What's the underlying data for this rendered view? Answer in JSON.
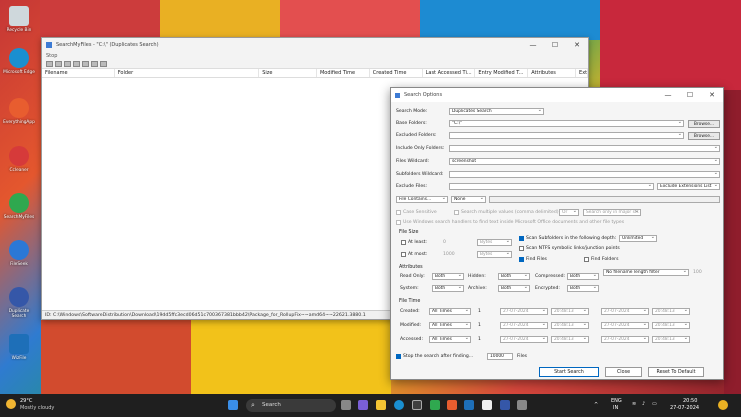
{
  "desktop": {
    "icons": [
      {
        "label": "Recycle Bin",
        "icon": "recycle-bin-icon",
        "color": "#cfd8dc"
      },
      {
        "label": "Microsoft Edge",
        "icon": "edge-icon",
        "color": "#1a8fd0"
      },
      {
        "label": "EverythingApp",
        "icon": "app-icon",
        "color": "#e85d2f"
      },
      {
        "label": "Ccleaner",
        "icon": "ccleaner-icon",
        "color": "#d63a3a"
      },
      {
        "label": "SearchMyFiles",
        "icon": "search-app-icon",
        "color": "#2fa84f"
      },
      {
        "label": "FileSeek",
        "icon": "fileseek-icon",
        "color": "#2b78d6"
      },
      {
        "label": "Duplicate Search",
        "icon": "disk-icon",
        "color": "#3557a8"
      },
      {
        "label": "WizFile",
        "icon": "wizfile-icon",
        "color": "#1e6fb8"
      }
    ]
  },
  "main_window": {
    "title": "SearchMyFiles - \"C:\\\" (Duplicates Search)",
    "menu": "Stop",
    "columns": [
      "Filename",
      "Folder",
      "Size",
      "Modified Time",
      "Created Time",
      "Last Accessed Ti...",
      "Entry Modified T...",
      "Attributes",
      "Exte"
    ],
    "status": "ID: C:\\Windows\\SoftwareDistribution\\Download\\19dd5ffc3ecd06d51c700367381bbb42\\Package_for_RollupFix~~amd64~~22621.3880.1"
  },
  "dialog": {
    "title": "Search Options",
    "search_mode_label": "Search Mode:",
    "search_mode_value": "Duplicates Search",
    "base_folders_label": "Base Folders:",
    "base_folders_value": "\"C:\\\"",
    "browse": "Browse...",
    "excluded_folders_label": "Excluded Folders:",
    "include_only_label": "Include Only Folders:",
    "files_wildcard_label": "Files Wildcard:",
    "files_wildcard_value": "screenshot",
    "subfolders_wildcard_label": "Subfolders Wildcard:",
    "exclude_files_label": "Exclude Files:",
    "exclude_ext": "Exclude Extensions List",
    "file_contains": "File Contains...",
    "none": "None",
    "case_sensitive": "Case Sensitive",
    "search_multiple": "Search multiple values (comma delimited)",
    "or_value": "Or",
    "search_major": "Search only in major str...",
    "use_windows": "Use Windows search handlers to find text inside Microsoft Office documents and other file types",
    "file_size": "File Size",
    "at_least": "At least:",
    "at_least_val": "0",
    "at_most": "At most:",
    "at_most_val": "1000",
    "bytes": "Bytes",
    "scan_subfolders": "Scan Subfolders in the following depth:",
    "unlimited": "Unlimited",
    "scan_ntfs": "Scan NTFS symbolic links/junction points",
    "find_files": "Find Files",
    "find_folders": "Find Folders",
    "attributes": "Attributes",
    "read_only": "Read Only:",
    "hidden": "Hidden:",
    "compressed": "Compressed:",
    "system": "System:",
    "archive": "Archive:",
    "encrypted": "Encrypted:",
    "both": "Both",
    "no_filename_limit": "No filename length filter",
    "limit_val": "100",
    "file_time": "File Time",
    "created": "Created:",
    "modified": "Modified:",
    "accessed": "Accessed:",
    "all_times": "All Times",
    "one": "1",
    "date": "27-07-2024",
    "time": "20:48:13",
    "stop_after": "Stop the search after finding...",
    "stop_val": "10000",
    "files_label": "Files",
    "start": "Start Search",
    "close": "Close",
    "reset": "Reset To Default"
  },
  "taskbar": {
    "weather_temp": "29°C",
    "weather_desc": "Mostly cloudy",
    "search_placeholder": "Search",
    "lang1": "ENG",
    "lang2": "IN",
    "clock_time": "20:50",
    "clock_date": "27-07-2024"
  }
}
